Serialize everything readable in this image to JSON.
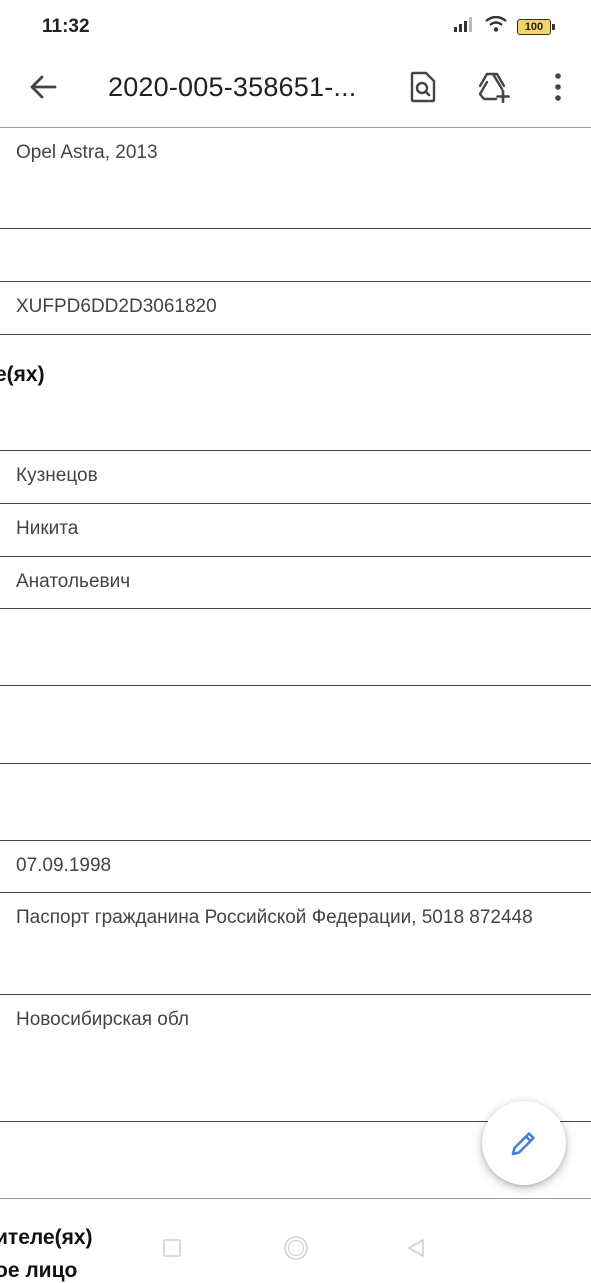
{
  "status_bar": {
    "time": "11:32",
    "battery": "100"
  },
  "toolbar": {
    "back_icon": "arrow-left-icon",
    "title": "2020-005-358651-...",
    "search_doc_icon": "document-search-icon",
    "drive_add_icon": "drive-add-icon",
    "more_icon": "more-vert-icon"
  },
  "fields": {
    "car_model": "Opel Astra, 2013",
    "vin": "XUFPD6DD2D3061820",
    "owner_section_title": "е(ях)",
    "last_name": "Кузнецов",
    "first_name": "Никита",
    "patronymic": "Анатольевич",
    "birth_date": "07.09.1998",
    "document": "Паспорт гражданина Российской Федерации, 5018 872448",
    "region": "Новосибирская обл",
    "bottom_section_title_1": "ителе(ях)",
    "bottom_section_title_2": "ое лицо"
  },
  "fab": {
    "icon": "edit-pencil-icon",
    "color": "#4a7fd4"
  },
  "nav_bar": {
    "recent_icon": "square-icon",
    "home_icon": "circle-icon",
    "back_icon": "triangle-back-icon"
  }
}
